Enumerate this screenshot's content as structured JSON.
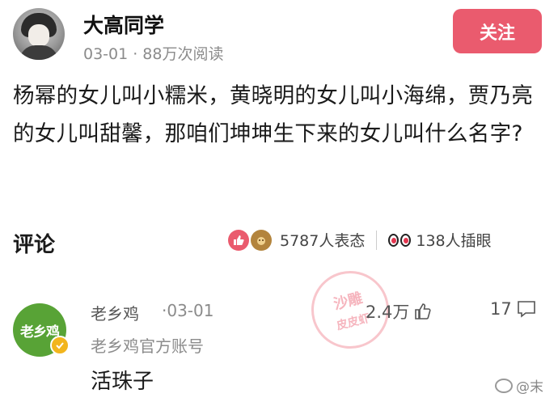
{
  "post": {
    "author": "大高同学",
    "date": "03-01",
    "separator": "·",
    "views": "88万次阅读",
    "follow_label": "关注",
    "body": "杨幂的女儿叫小糯米，黄晓明的女儿叫小海绵，贾乃亮的女儿叫甜馨，那咱们坤坤生下来的女儿叫什么名字?"
  },
  "comments_section": {
    "title": "评论",
    "reactions_count": "5787人表态",
    "watch_count": "138人插眼"
  },
  "comment": {
    "avatar_text": "老乡鸡",
    "author": "老乡鸡",
    "date": "·03-01",
    "subtitle": "老乡鸡官方账号",
    "text": "活珠子",
    "likes": "2.4万",
    "replies": "17"
  },
  "stamp": {
    "line1": "沙雕",
    "line2": "皮皮虾"
  },
  "watermark": {
    "text": "@末"
  },
  "colors": {
    "accent": "#ea5b6e",
    "meta_gray": "#8b8b8b",
    "brand_green": "#58a336",
    "verified_gold": "#f2b51d"
  }
}
